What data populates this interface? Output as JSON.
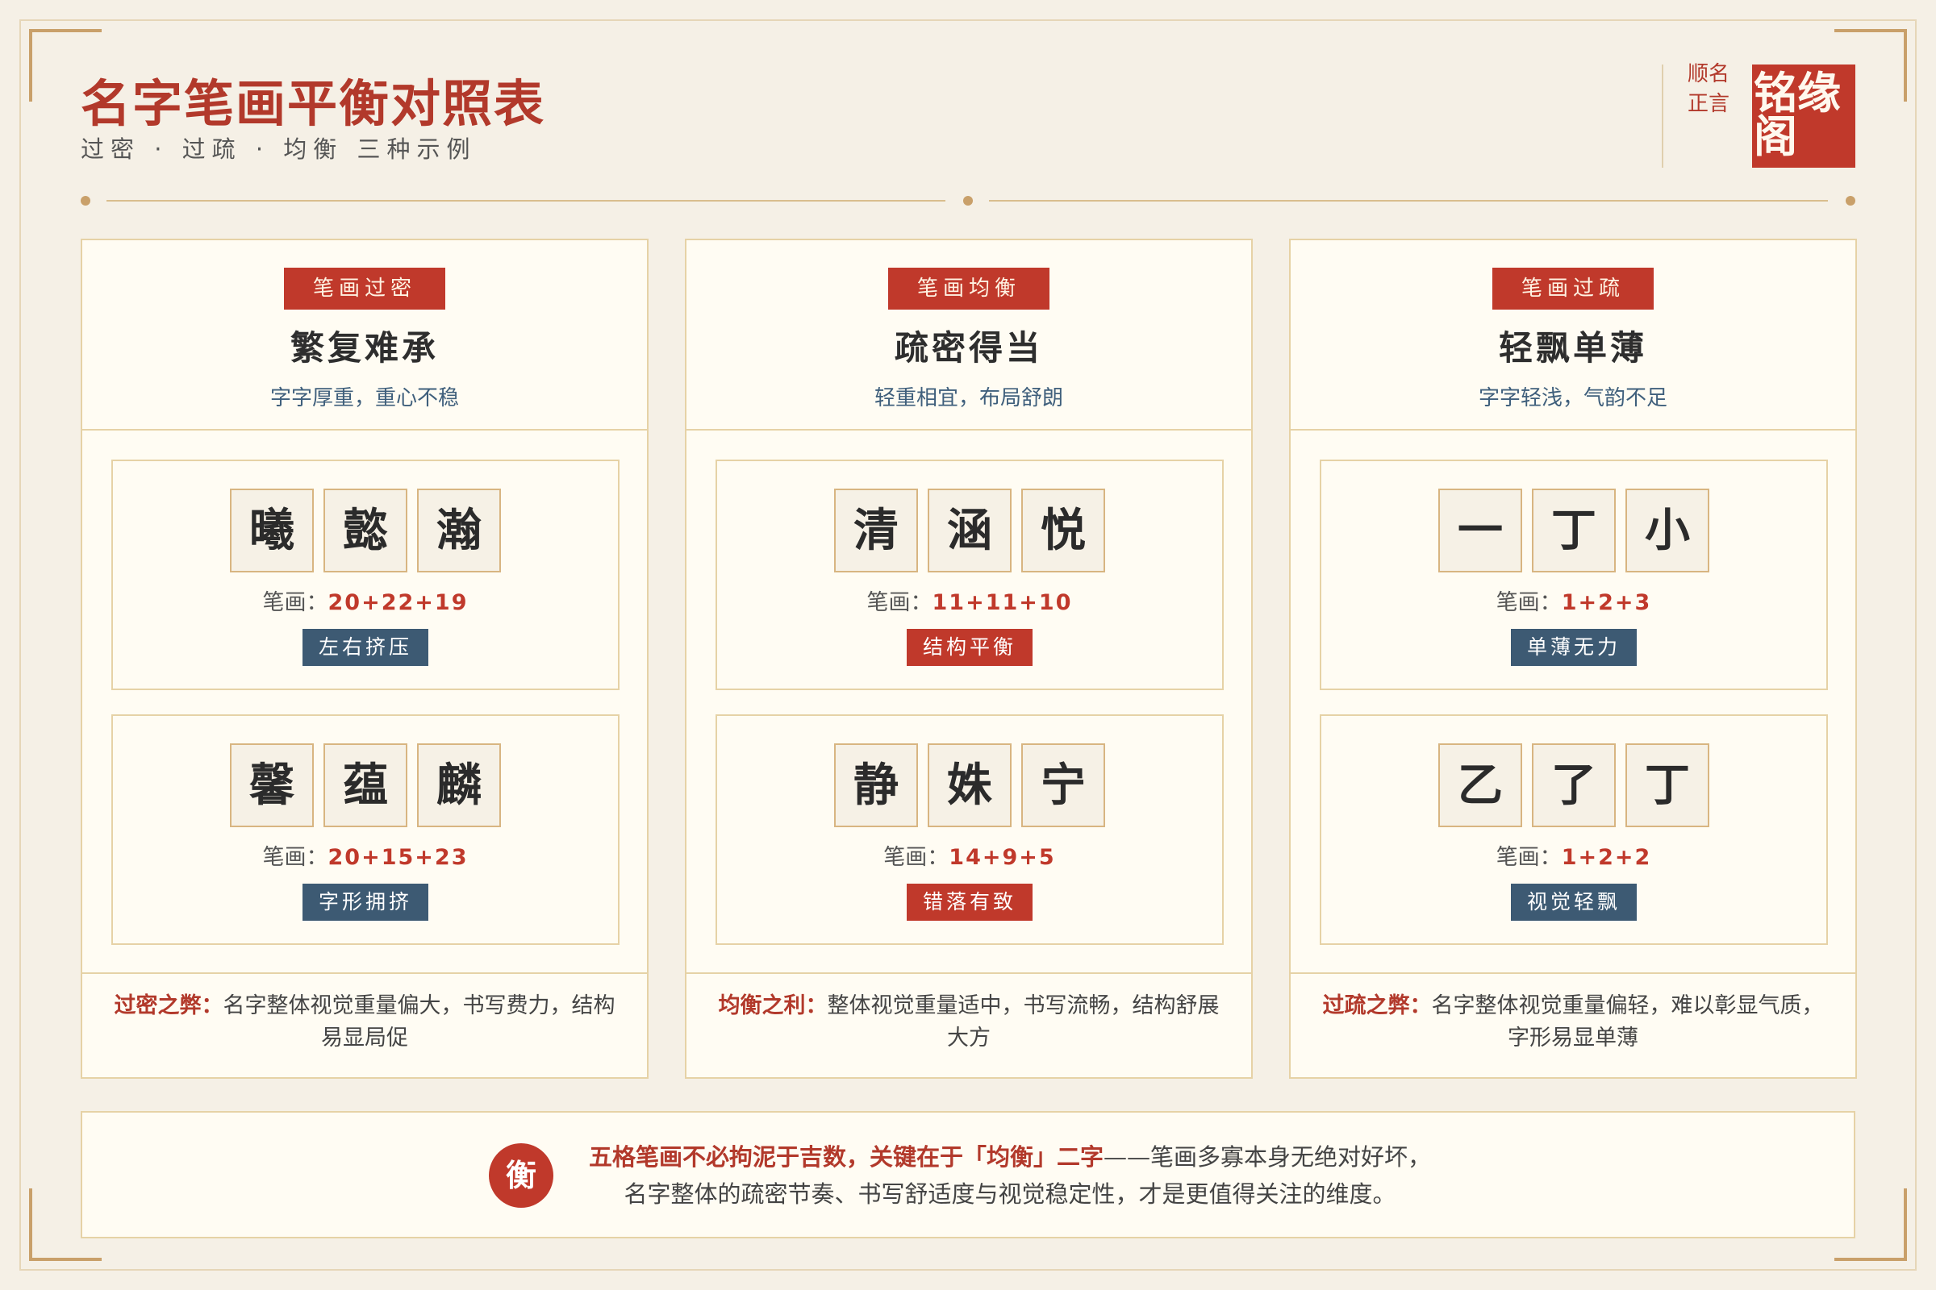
{
  "header": {
    "title": "名字笔画平衡对照表",
    "subtitle": "过密 · 过疏 · 均衡 三种示例",
    "motto": "顺名正言",
    "seal": "铭缘阁"
  },
  "cards": [
    {
      "badge": "笔画过密",
      "title": "繁复难承",
      "subtitle": "字字厚重，重心不稳",
      "examples": [
        {
          "chars": [
            "曦",
            "懿",
            "瀚"
          ],
          "strokes_label": "笔画：",
          "strokes": "20+22+19",
          "tag": "左右挤压",
          "tag_color": "#3d5a73"
        },
        {
          "chars": [
            "馨",
            "蕴",
            "麟"
          ],
          "strokes_label": "笔画：",
          "strokes": "20+15+23",
          "tag": "字形拥挤",
          "tag_color": "#3d5a73"
        }
      ],
      "foot_key": "过密之弊：",
      "foot_text": "名字整体视觉重量偏大，书写费力，结构易显局促"
    },
    {
      "badge": "笔画均衡",
      "title": "疏密得当",
      "subtitle": "轻重相宜，布局舒朗",
      "examples": [
        {
          "chars": [
            "清",
            "涵",
            "悦"
          ],
          "strokes_label": "笔画：",
          "strokes": "11+11+10",
          "tag": "结构平衡",
          "tag_color": "#c0392b"
        },
        {
          "chars": [
            "静",
            "姝",
            "宁"
          ],
          "strokes_label": "笔画：",
          "strokes": "14+9+5",
          "tag": "错落有致",
          "tag_color": "#c0392b"
        }
      ],
      "foot_key": "均衡之利：",
      "foot_text": "整体视觉重量适中，书写流畅，结构舒展大方"
    },
    {
      "badge": "笔画过疏",
      "title": "轻飘单薄",
      "subtitle": "字字轻浅，气韵不足",
      "examples": [
        {
          "chars": [
            "一",
            "丁",
            "小"
          ],
          "strokes_label": "笔画：",
          "strokes": "1+2+3",
          "tag": "单薄无力",
          "tag_color": "#3d5a73"
        },
        {
          "chars": [
            "乙",
            "了",
            "丁"
          ],
          "strokes_label": "笔画：",
          "strokes": "1+2+2",
          "tag": "视觉轻飘",
          "tag_color": "#3d5a73"
        }
      ],
      "foot_key": "过疏之弊：",
      "foot_text": "名字整体视觉重量偏轻，难以彰显气质，字形易显单薄"
    }
  ],
  "bottom": {
    "icon_char": "衡",
    "key": "五格笔画不必拘泥于吉数，关键在于「均衡」二字",
    "line1_rest": "——笔画多寡本身无绝对好坏，",
    "line2": "名字整体的疏密节奏、书写舒适度与视觉稳定性，才是更值得关注的维度。"
  },
  "colors": {
    "accent": "#c0392b",
    "blue": "#3d5a73",
    "gold": "#c9a06a",
    "background": "#f5f0e6"
  }
}
